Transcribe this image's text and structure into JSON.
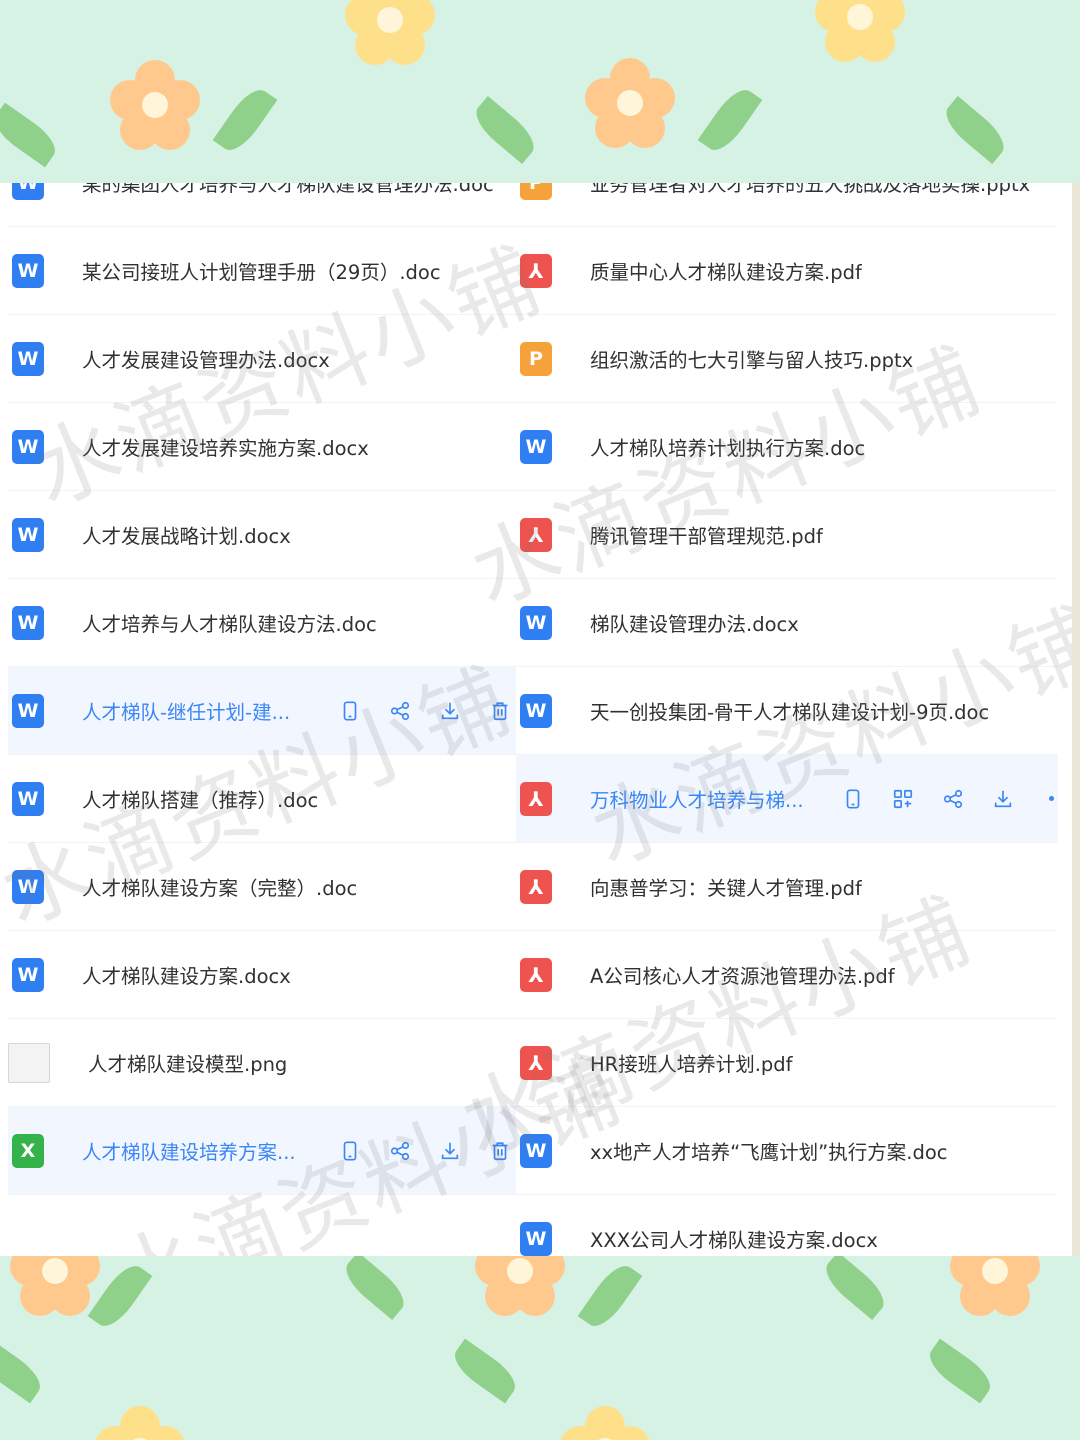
{
  "files_left": [
    {
      "name": "某的集团人才培养与人才梯队建设管理办法.doc",
      "type": "word"
    },
    {
      "name": "某公司接班人计划管理手册（29页）.doc",
      "type": "word"
    },
    {
      "name": "人才发展建设管理办法.docx",
      "type": "word"
    },
    {
      "name": "人才发展建设培养实施方案.docx",
      "type": "word"
    },
    {
      "name": "人才发展战略计划.docx",
      "type": "word"
    },
    {
      "name": "人才培养与人才梯队建设方法.doc",
      "type": "word"
    },
    {
      "name": "人才梯队-继任计划-建...",
      "type": "word"
    },
    {
      "name": "人才梯队搭建（推荐）.doc",
      "type": "word"
    },
    {
      "name": "人才梯队建设方案（完整）.doc",
      "type": "word"
    },
    {
      "name": "人才梯队建设方案.docx",
      "type": "word"
    },
    {
      "name": "人才梯队建设模型.png",
      "type": "image"
    },
    {
      "name": "人才梯队建设培养方案...",
      "type": "excel"
    }
  ],
  "files_right": [
    {
      "name": "业务管理者对人才培养的五大挑战及落地实操.pptx",
      "type": "ppt"
    },
    {
      "name": "质量中心人才梯队建设方案.pdf",
      "type": "pdf"
    },
    {
      "name": "组织激活的七大引擎与留人技巧.pptx",
      "type": "ppt"
    },
    {
      "name": "人才梯队培养计划执行方案.doc",
      "type": "word"
    },
    {
      "name": "腾讯管理干部管理规范.pdf",
      "type": "pdf"
    },
    {
      "name": "梯队建设管理办法.docx",
      "type": "word"
    },
    {
      "name": "天一创投集团-骨干人才梯队建设计划-9页.doc",
      "type": "word"
    },
    {
      "name": "万科物业人才培养与梯...",
      "type": "pdf"
    },
    {
      "name": "向惠普学习：关键人才管理.pdf",
      "type": "pdf"
    },
    {
      "name": "A公司核心人才资源池管理办法.pdf",
      "type": "pdf"
    },
    {
      "name": "HR接班人培养计划.pdf",
      "type": "pdf"
    },
    {
      "name": "xx地产人才培养“飞鹰计划”执行方案.doc",
      "type": "word"
    },
    {
      "name": "XXX公司人才梯队建设方案.docx",
      "type": "word"
    }
  ],
  "icons": {
    "word": "W",
    "pdf": "⅄",
    "ppt": "P",
    "excel": "X"
  },
  "watermark": "水滴资料小铺",
  "colors": {
    "accent": "#3a86f5",
    "word": "#2f7ff3",
    "pdf": "#ef5350",
    "ppt": "#f5a23a",
    "excel": "#33b34a",
    "background": "#d6f2e5"
  }
}
